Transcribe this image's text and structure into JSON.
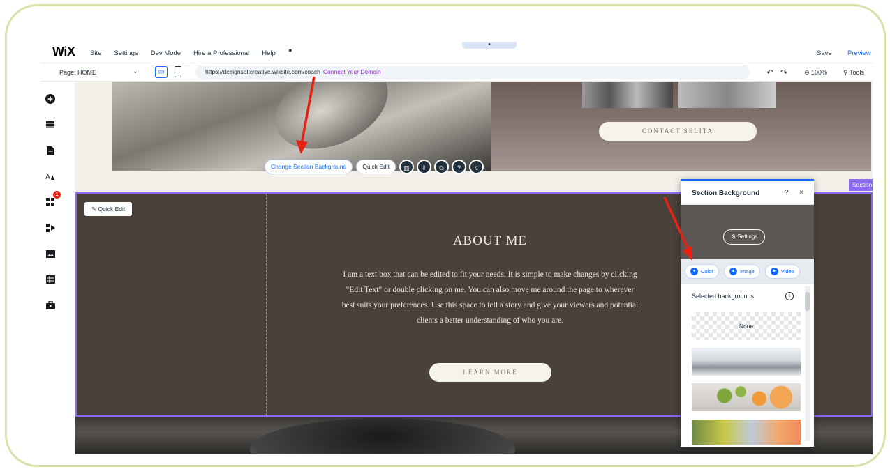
{
  "topbar": {
    "logo": "WiX",
    "menu": [
      "Site",
      "Settings",
      "Dev Mode",
      "Hire a Professional",
      "Help"
    ],
    "collapse_glyph": "▲",
    "save": "Save",
    "preview": "Preview"
  },
  "addressbar": {
    "page_label": "Page: HOME",
    "url": "https://designsaltcreative.wixsite.com/coach",
    "connect_domain": "Connect Your Domain",
    "zoom": "⊖ 100%",
    "tools": "Tools"
  },
  "sidebar": {
    "icons": [
      "add-icon",
      "sections-icon",
      "pages-icon",
      "design-icon",
      "apps-icon",
      "business-icon",
      "media-icon",
      "cms-icon",
      "portfolio-icon"
    ],
    "apps_badge": "1"
  },
  "canvas": {
    "contact_button": "CONTACT SELITA",
    "section_toolbar": {
      "change_bg": "Change Section Background",
      "quick_edit": "Quick Edit"
    },
    "section_tag": "Section",
    "about": {
      "quick_edit": "Quick Edit",
      "title": "ABOUT ME",
      "body": "I am a text box that can be edited to fit your needs. It is simple to make changes by clicking \"Edit Text\" or double clicking on me. You can also move me around the page to wherever best suits your preferences. Use this space to tell a story and give your viewers and potential clients a better understanding of who you are.",
      "button": "LEARN MORE"
    }
  },
  "panel": {
    "title": "Section Background",
    "help": "?",
    "close": "×",
    "settings": "Settings",
    "tabs": [
      "Color",
      "Image",
      "Video"
    ],
    "selected_label": "Selected backgrounds",
    "none_label": "None"
  },
  "colors": {
    "accent_blue": "#116dff",
    "selection_purple": "#8b67f3",
    "about_bg": "#4a413b",
    "arrow_red": "#e62214",
    "frame_green": "#d4e3a7"
  }
}
